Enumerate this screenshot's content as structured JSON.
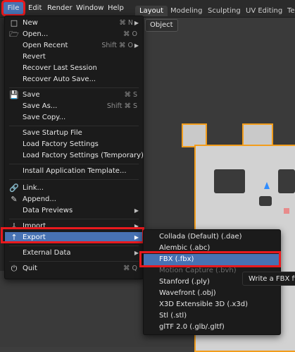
{
  "topbar": {
    "file": "File",
    "edit": "Edit",
    "render": "Render",
    "window": "Window",
    "help": "Help"
  },
  "workspace_tabs": [
    "Layout",
    "Modeling",
    "Sculpting",
    "UV Editing",
    "Te"
  ],
  "viewport": {
    "mode_button": "Object"
  },
  "file_menu": {
    "new": {
      "label": "New",
      "shortcut": "⌘ N"
    },
    "open": {
      "label": "Open...",
      "shortcut": "⌘ O"
    },
    "open_recent": {
      "label": "Open Recent",
      "shortcut": "Shift ⌘ O"
    },
    "revert": {
      "label": "Revert"
    },
    "recover_last": {
      "label": "Recover Last Session"
    },
    "recover_auto": {
      "label": "Recover Auto Save..."
    },
    "save": {
      "label": "Save",
      "shortcut": "⌘ S"
    },
    "save_as": {
      "label": "Save As...",
      "shortcut": "Shift ⌘ S"
    },
    "save_copy": {
      "label": "Save Copy..."
    },
    "save_startup": {
      "label": "Save Startup File"
    },
    "load_factory": {
      "label": "Load Factory Settings"
    },
    "load_factory_temp": {
      "label": "Load Factory Settings (Temporary)"
    },
    "install_template": {
      "label": "Install Application Template..."
    },
    "link": {
      "label": "Link..."
    },
    "append": {
      "label": "Append..."
    },
    "data_previews": {
      "label": "Data Previews"
    },
    "import": {
      "label": "Import"
    },
    "export": {
      "label": "Export"
    },
    "external_data": {
      "label": "External Data"
    },
    "quit": {
      "label": "Quit",
      "shortcut": "⌘ Q"
    }
  },
  "export_menu": {
    "items": [
      "Collada (Default) (.dae)",
      "Alembic (.abc)",
      "FBX (.fbx)",
      "Motion Capture (.bvh)",
      "Stanford (.ply)",
      "Wavefront (.obj)",
      "X3D Extensible 3D (.x3d)",
      "Stl (.stl)",
      "glTF 2.0 (.glb/.gltf)"
    ]
  },
  "tooltip": {
    "text": "Write a FBX file"
  },
  "colors": {
    "highlight": "#4772b3",
    "annotation_red": "#e8191d",
    "selection_orange": "#f29d1c"
  }
}
